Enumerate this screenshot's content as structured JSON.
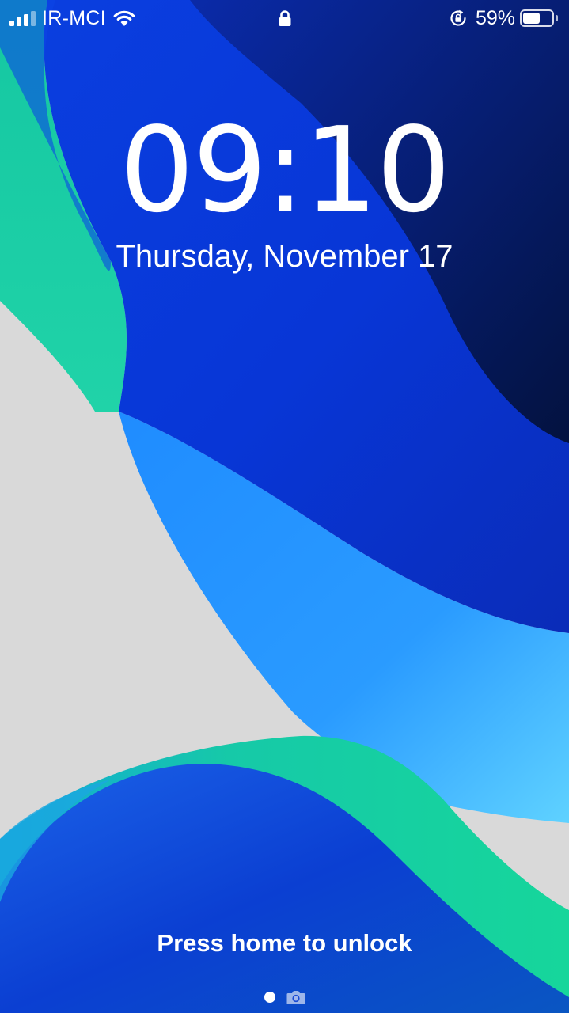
{
  "status_bar": {
    "carrier": "IR-MCI",
    "battery_percent_text": "59%",
    "battery_level": 0.59,
    "signal_bars_filled": 3,
    "signal_bars_total": 4,
    "icons": [
      "signal-icon",
      "wifi-icon",
      "lock-icon",
      "rotation-lock-icon",
      "battery-icon"
    ]
  },
  "lock_screen": {
    "time": "09:10",
    "date": "Thursday, November 17",
    "unlock_hint": "Press home to unlock"
  },
  "page_indicator": {
    "items": [
      "dot",
      "camera-icon"
    ]
  },
  "colors": {
    "wallpaper_light": "#d9d9d9",
    "wallpaper_deep_blue": "#0a2fc9",
    "wallpaper_navy": "#05164d",
    "wallpaper_sky": "#2a9bff",
    "wallpaper_green": "#18d3a0",
    "text": "#ffffff"
  }
}
